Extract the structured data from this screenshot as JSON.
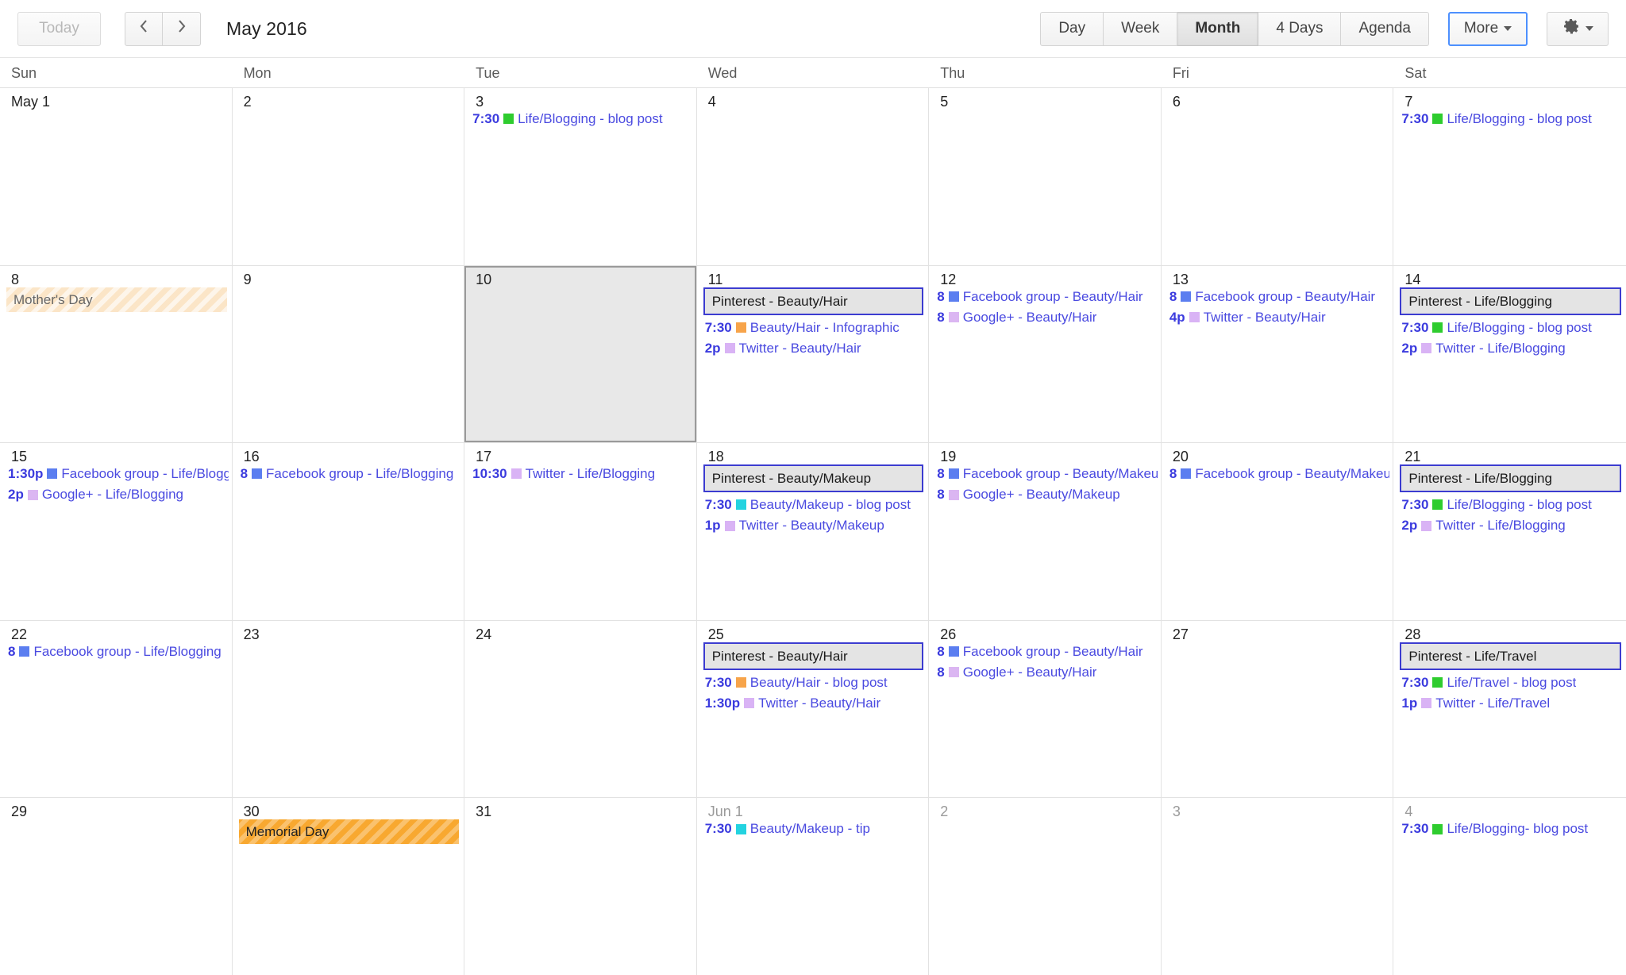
{
  "toolbar": {
    "today_label": "Today",
    "prev_label": "prev-month",
    "next_label": "next-month",
    "period_title": "May 2016",
    "views": [
      {
        "label": "Day",
        "active": false
      },
      {
        "label": "Week",
        "active": false
      },
      {
        "label": "Month",
        "active": true
      },
      {
        "label": "4 Days",
        "active": false
      },
      {
        "label": "Agenda",
        "active": false
      }
    ],
    "more_label": "More",
    "settings_label": "settings"
  },
  "daynames": [
    "Sun",
    "Mon",
    "Tue",
    "Wed",
    "Thu",
    "Fri",
    "Sat"
  ],
  "colors": {
    "accent_blue": "#4d90fe",
    "event_text": "#3b3bde",
    "cal_life_blogging": "#2ecc2e",
    "cal_beauty_hair": "#f7a44a",
    "cal_beauty_makeup": "#23d3e0",
    "cal_facebook": "#5b7ef0",
    "cal_google_plus": "#dbb6f2",
    "cal_twitter": "#d9b3f5",
    "cal_life_travel": "#2ecc2e",
    "allday_bg": "#e4e4e4",
    "allday_border": "#3c3cd0",
    "holiday_pale": "#fbe5c7",
    "holiday_strong": "#f8a830",
    "selected_cell": "#e8e8e8"
  },
  "weeks": [
    {
      "days": [
        {
          "date": "May 1",
          "othermonth": false,
          "selected": false,
          "events": []
        },
        {
          "date": "2",
          "othermonth": false,
          "selected": false,
          "events": []
        },
        {
          "date": "3",
          "othermonth": false,
          "selected": false,
          "events": [
            {
              "kind": "timed",
              "time": "7:30",
              "title": "Life/Blogging - blog post",
              "color": "#2ecc2e"
            }
          ]
        },
        {
          "date": "4",
          "othermonth": false,
          "selected": false,
          "events": []
        },
        {
          "date": "5",
          "othermonth": false,
          "selected": false,
          "events": []
        },
        {
          "date": "6",
          "othermonth": false,
          "selected": false,
          "events": []
        },
        {
          "date": "7",
          "othermonth": false,
          "selected": false,
          "events": [
            {
              "kind": "timed",
              "time": "7:30",
              "title": "Life/Blogging - blog post",
              "color": "#2ecc2e"
            }
          ]
        }
      ]
    },
    {
      "days": [
        {
          "date": "8",
          "othermonth": false,
          "selected": false,
          "events": [
            {
              "kind": "holiday",
              "style": "pale",
              "title": "Mother's Day"
            }
          ]
        },
        {
          "date": "9",
          "othermonth": false,
          "selected": false,
          "events": []
        },
        {
          "date": "10",
          "othermonth": false,
          "selected": true,
          "events": []
        },
        {
          "date": "11",
          "othermonth": false,
          "selected": false,
          "events": [
            {
              "kind": "allday",
              "title": "Pinterest - Beauty/Hair"
            },
            {
              "kind": "timed",
              "time": "7:30",
              "title": "Beauty/Hair - Infographic",
              "color": "#f7a44a"
            },
            {
              "kind": "timed",
              "time": "2p",
              "title": "Twitter - Beauty/Hair",
              "color": "#d9b3f5"
            }
          ]
        },
        {
          "date": "12",
          "othermonth": false,
          "selected": false,
          "events": [
            {
              "kind": "timed",
              "time": "8",
              "title": "Facebook group - Beauty/Hair",
              "color": "#5b7ef0"
            },
            {
              "kind": "timed",
              "time": "8",
              "title": "Google+ - Beauty/Hair",
              "color": "#dbb6f2"
            }
          ]
        },
        {
          "date": "13",
          "othermonth": false,
          "selected": false,
          "events": [
            {
              "kind": "timed",
              "time": "8",
              "title": "Facebook group - Beauty/Hair",
              "color": "#5b7ef0"
            },
            {
              "kind": "timed",
              "time": "4p",
              "title": "Twitter - Beauty/Hair",
              "color": "#d9b3f5"
            }
          ]
        },
        {
          "date": "14",
          "othermonth": false,
          "selected": false,
          "events": [
            {
              "kind": "allday",
              "title": "Pinterest - Life/Blogging"
            },
            {
              "kind": "timed",
              "time": "7:30",
              "title": "Life/Blogging - blog post",
              "color": "#2ecc2e"
            },
            {
              "kind": "timed",
              "time": "2p",
              "title": "Twitter - Life/Blogging",
              "color": "#d9b3f5"
            }
          ]
        }
      ]
    },
    {
      "days": [
        {
          "date": "15",
          "othermonth": false,
          "selected": false,
          "events": [
            {
              "kind": "timed",
              "time": "1:30p",
              "title": "Facebook group - Life/Bloggi",
              "color": "#5b7ef0"
            },
            {
              "kind": "timed",
              "time": "2p",
              "title": "Google+ - Life/Blogging",
              "color": "#dbb6f2"
            }
          ]
        },
        {
          "date": "16",
          "othermonth": false,
          "selected": false,
          "events": [
            {
              "kind": "timed",
              "time": "8",
              "title": "Facebook group - Life/Blogging",
              "color": "#5b7ef0"
            }
          ]
        },
        {
          "date": "17",
          "othermonth": false,
          "selected": false,
          "events": [
            {
              "kind": "timed",
              "time": "10:30",
              "title": "Twitter - Life/Blogging",
              "color": "#d9b3f5"
            }
          ]
        },
        {
          "date": "18",
          "othermonth": false,
          "selected": false,
          "events": [
            {
              "kind": "allday",
              "title": "Pinterest - Beauty/Makeup"
            },
            {
              "kind": "timed",
              "time": "7:30",
              "title": "Beauty/Makeup - blog post",
              "color": "#23d3e0"
            },
            {
              "kind": "timed",
              "time": "1p",
              "title": "Twitter - Beauty/Makeup",
              "color": "#d9b3f5"
            }
          ]
        },
        {
          "date": "19",
          "othermonth": false,
          "selected": false,
          "events": [
            {
              "kind": "timed",
              "time": "8",
              "title": "Facebook group - Beauty/Makeup",
              "color": "#5b7ef0"
            },
            {
              "kind": "timed",
              "time": "8",
              "title": "Google+ - Beauty/Makeup",
              "color": "#dbb6f2"
            }
          ]
        },
        {
          "date": "20",
          "othermonth": false,
          "selected": false,
          "events": [
            {
              "kind": "timed",
              "time": "8",
              "title": "Facebook group - Beauty/Makeup",
              "color": "#5b7ef0"
            }
          ]
        },
        {
          "date": "21",
          "othermonth": false,
          "selected": false,
          "events": [
            {
              "kind": "allday",
              "title": "Pinterest - Life/Blogging"
            },
            {
              "kind": "timed",
              "time": "7:30",
              "title": "Life/Blogging - blog post",
              "color": "#2ecc2e"
            },
            {
              "kind": "timed",
              "time": "2p",
              "title": "Twitter - Life/Blogging",
              "color": "#d9b3f5"
            }
          ]
        }
      ]
    },
    {
      "days": [
        {
          "date": "22",
          "othermonth": false,
          "selected": false,
          "events": [
            {
              "kind": "timed",
              "time": "8",
              "title": "Facebook group - Life/Blogging",
              "color": "#5b7ef0"
            }
          ]
        },
        {
          "date": "23",
          "othermonth": false,
          "selected": false,
          "events": []
        },
        {
          "date": "24",
          "othermonth": false,
          "selected": false,
          "events": []
        },
        {
          "date": "25",
          "othermonth": false,
          "selected": false,
          "events": [
            {
              "kind": "allday",
              "title": "Pinterest - Beauty/Hair"
            },
            {
              "kind": "timed",
              "time": "7:30",
              "title": "Beauty/Hair - blog post",
              "color": "#f7a44a"
            },
            {
              "kind": "timed",
              "time": "1:30p",
              "title": "Twitter - Beauty/Hair",
              "color": "#d9b3f5"
            }
          ]
        },
        {
          "date": "26",
          "othermonth": false,
          "selected": false,
          "events": [
            {
              "kind": "timed",
              "time": "8",
              "title": "Facebook group - Beauty/Hair",
              "color": "#5b7ef0"
            },
            {
              "kind": "timed",
              "time": "8",
              "title": "Google+ - Beauty/Hair",
              "color": "#dbb6f2"
            }
          ]
        },
        {
          "date": "27",
          "othermonth": false,
          "selected": false,
          "events": []
        },
        {
          "date": "28",
          "othermonth": false,
          "selected": false,
          "events": [
            {
              "kind": "allday",
              "title": "Pinterest - Life/Travel"
            },
            {
              "kind": "timed",
              "time": "7:30",
              "title": "Life/Travel - blog post",
              "color": "#2ecc2e"
            },
            {
              "kind": "timed",
              "time": "1p",
              "title": "Twitter - Life/Travel",
              "color": "#d9b3f5"
            }
          ]
        }
      ]
    },
    {
      "days": [
        {
          "date": "29",
          "othermonth": false,
          "selected": false,
          "events": []
        },
        {
          "date": "30",
          "othermonth": false,
          "selected": false,
          "events": [
            {
              "kind": "holiday",
              "style": "strong",
              "title": "Memorial Day"
            }
          ]
        },
        {
          "date": "31",
          "othermonth": false,
          "selected": false,
          "events": []
        },
        {
          "date": "Jun 1",
          "othermonth": true,
          "selected": false,
          "events": [
            {
              "kind": "timed",
              "time": "7:30",
              "title": "Beauty/Makeup - tip",
              "color": "#23d3e0"
            }
          ]
        },
        {
          "date": "2",
          "othermonth": true,
          "selected": false,
          "events": []
        },
        {
          "date": "3",
          "othermonth": true,
          "selected": false,
          "events": []
        },
        {
          "date": "4",
          "othermonth": true,
          "selected": false,
          "events": [
            {
              "kind": "timed",
              "time": "7:30",
              "title": "Life/Blogging- blog post",
              "color": "#2ecc2e"
            }
          ]
        }
      ]
    }
  ]
}
